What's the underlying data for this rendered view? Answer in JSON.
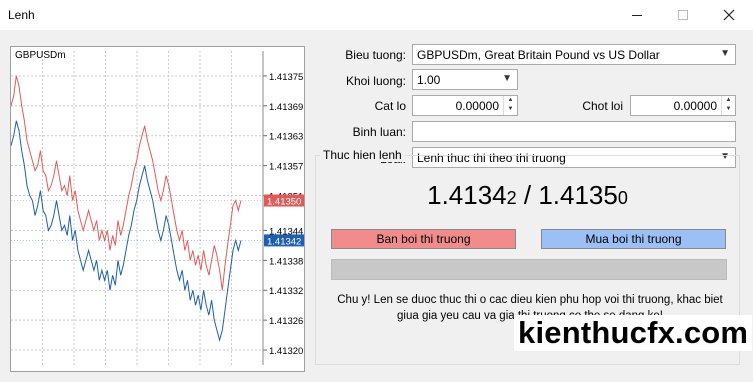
{
  "window": {
    "title": "Lenh"
  },
  "chart": {
    "symbol": "GBPUSDm",
    "sell_color": "#e05a5a",
    "buy_color": "#1d5fb0",
    "ask_label_bg": "#e05a5a",
    "bid_label_bg": "#1d5fb0"
  },
  "chart_data": {
    "type": "line",
    "title": "GBPUSDm",
    "ylim": [
      1.41317,
      1.4138
    ],
    "y_ticks": [
      "1.41375",
      "1.41369",
      "1.41363",
      "1.41357",
      "1.41351",
      "1.41344",
      "1.41338",
      "1.41332",
      "1.41326",
      "1.41320"
    ],
    "current_ask": "1.41350",
    "current_bid": "1.41342",
    "series": [
      {
        "values": [
          1.41369,
          1.41371,
          1.41375,
          1.41373,
          1.41369,
          1.41366,
          1.41362,
          1.4136,
          1.41358,
          1.41356,
          1.41357,
          1.4136,
          1.41356,
          1.41355,
          1.41352,
          1.41353,
          1.41355,
          1.41358,
          1.41355,
          1.41352,
          1.41353,
          1.41351,
          1.41355,
          1.4135,
          1.41352,
          1.41348,
          1.41346,
          1.41344,
          1.41346,
          1.41348,
          1.41346,
          1.41344,
          1.41346,
          1.41342,
          1.41344,
          1.41342,
          1.41344,
          1.4134,
          1.41343,
          1.41341,
          1.41346,
          1.41343,
          1.41345,
          1.41348,
          1.41351,
          1.41353,
          1.41356,
          1.41358,
          1.41361,
          1.41363,
          1.41365,
          1.41362,
          1.4136,
          1.41358,
          1.41355,
          1.41352,
          1.4135,
          1.41352,
          1.41355,
          1.41353,
          1.4135,
          1.41347,
          1.41344,
          1.41342,
          1.41344,
          1.4134,
          1.41342,
          1.41338,
          1.4134,
          1.41337,
          1.41339,
          1.41336,
          1.4134,
          1.41337,
          1.41335,
          1.41338,
          1.41341,
          1.41339,
          1.41336,
          1.41332,
          1.41337,
          1.41341,
          1.41345,
          1.41349,
          1.4135,
          1.41348,
          1.4135
        ]
      },
      {
        "values": [
          1.41361,
          1.41363,
          1.41366,
          1.41364,
          1.4136,
          1.41357,
          1.41353,
          1.41351,
          1.4135,
          1.41347,
          1.41349,
          1.41352,
          1.41348,
          1.41347,
          1.41344,
          1.41345,
          1.41347,
          1.4135,
          1.41347,
          1.41344,
          1.41345,
          1.41343,
          1.41347,
          1.41342,
          1.41344,
          1.4134,
          1.41338,
          1.41336,
          1.41338,
          1.4134,
          1.41338,
          1.41336,
          1.41338,
          1.41334,
          1.41336,
          1.41334,
          1.41336,
          1.41332,
          1.41335,
          1.41333,
          1.41338,
          1.41335,
          1.41337,
          1.4134,
          1.41343,
          1.41345,
          1.41348,
          1.4135,
          1.41353,
          1.41355,
          1.41357,
          1.41354,
          1.41352,
          1.4135,
          1.41347,
          1.41344,
          1.41342,
          1.41344,
          1.41347,
          1.41345,
          1.41342,
          1.41339,
          1.41336,
          1.41334,
          1.41336,
          1.41332,
          1.41334,
          1.4133,
          1.41332,
          1.41329,
          1.41331,
          1.41328,
          1.41332,
          1.41329,
          1.41327,
          1.4133,
          1.41326,
          1.41324,
          1.41322,
          1.41324,
          1.41328,
          1.41332,
          1.41336,
          1.4134,
          1.41342,
          1.4134,
          1.41342
        ]
      }
    ]
  },
  "form": {
    "symbol_label": "Bieu tuong:",
    "symbol_value": "GBPUSDm, Great Britain Pound vs US Dollar",
    "volume_label": "Khoi luong:",
    "volume_value": "1.00",
    "stoploss_label": "Cat lo",
    "stoploss_value": "0.00000",
    "takeprofit_label": "Chot loi",
    "takeprofit_value": "0.00000",
    "comment_label": "Binh luan:",
    "comment_value": "",
    "type_label": "Loai:",
    "type_value": "Lenh thuc thi theo thi truong"
  },
  "execution": {
    "group_title": "Thuc hien lenh",
    "bid_main": "1.4134",
    "bid_small": "2",
    "separator": " / ",
    "ask_main": "1.4135",
    "ask_small": "0",
    "sell_button": "Ban boi thi truong",
    "buy_button": "Mua boi thi truong",
    "note": "Chu y! Len se duoc thuc thi o cac dieu kien phu hop voi thi truong, khac biet giua gia yeu cau va gia thi truong co the se dang ke!"
  },
  "watermark": "kienthucfx.com"
}
